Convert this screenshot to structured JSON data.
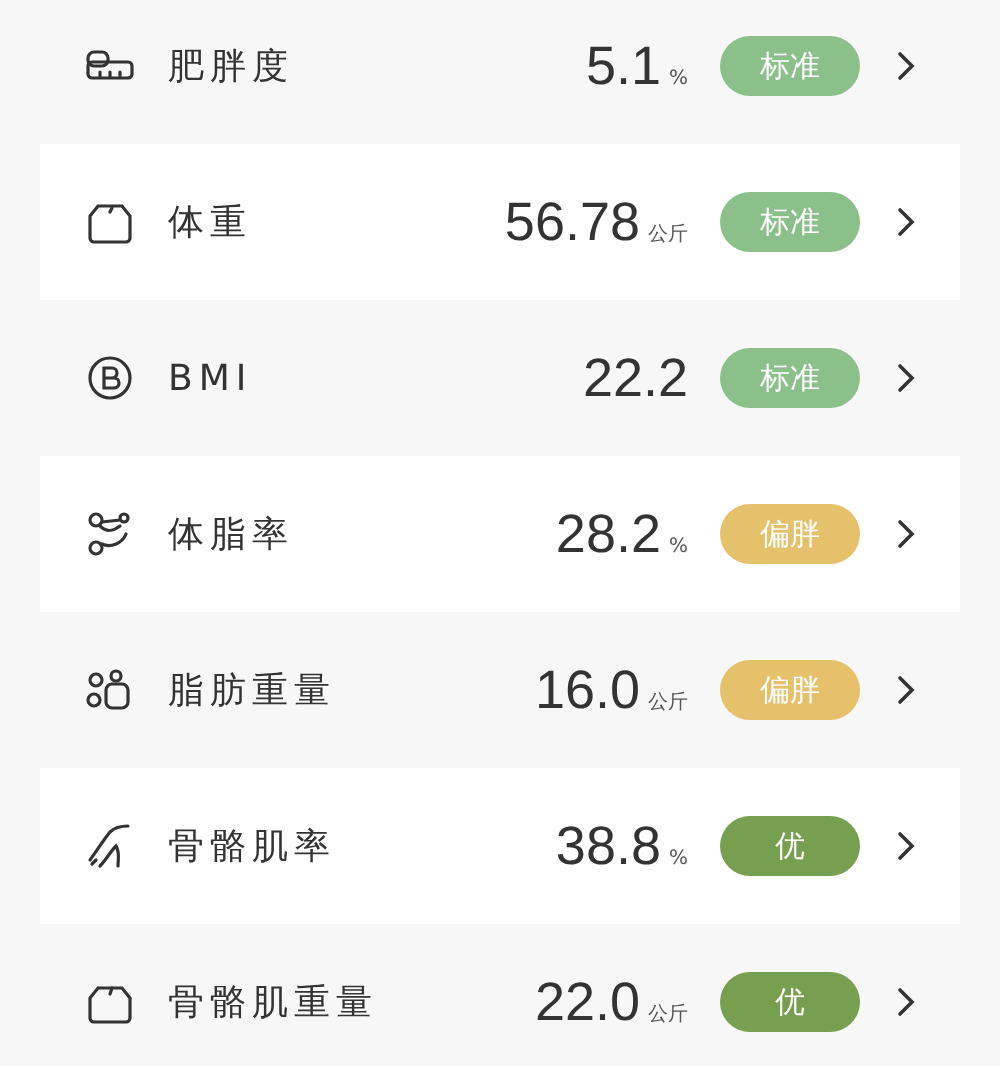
{
  "metrics": [
    {
      "label": "肥胖度",
      "value": "5.1",
      "unit": "%",
      "badge": {
        "text": "标准",
        "color": "#8cc08a"
      }
    },
    {
      "label": "体重",
      "value": "56.78",
      "unit": "公斤",
      "badge": {
        "text": "标准",
        "color": "#8cc08a"
      }
    },
    {
      "label": "BMI",
      "value": "22.2",
      "badge": {
        "text": "标准",
        "color": "#8cc08a"
      }
    },
    {
      "label": "体脂率",
      "value": "28.2",
      "unit": "%",
      "badge": {
        "text": "偏胖",
        "color": "#e6c16b"
      }
    },
    {
      "label": "脂肪重量",
      "value": "16.0",
      "unit": "公斤",
      "badge": {
        "text": "偏胖",
        "color": "#e6c16b"
      }
    },
    {
      "label": "骨骼肌率",
      "value": "38.8",
      "unit": "%",
      "badge": {
        "text": "优",
        "color": "#76a04f"
      }
    },
    {
      "label": "骨骼肌重量",
      "value": "22.0",
      "unit": "公斤",
      "badge": {
        "text": "优",
        "color": "#76a04f"
      }
    }
  ]
}
